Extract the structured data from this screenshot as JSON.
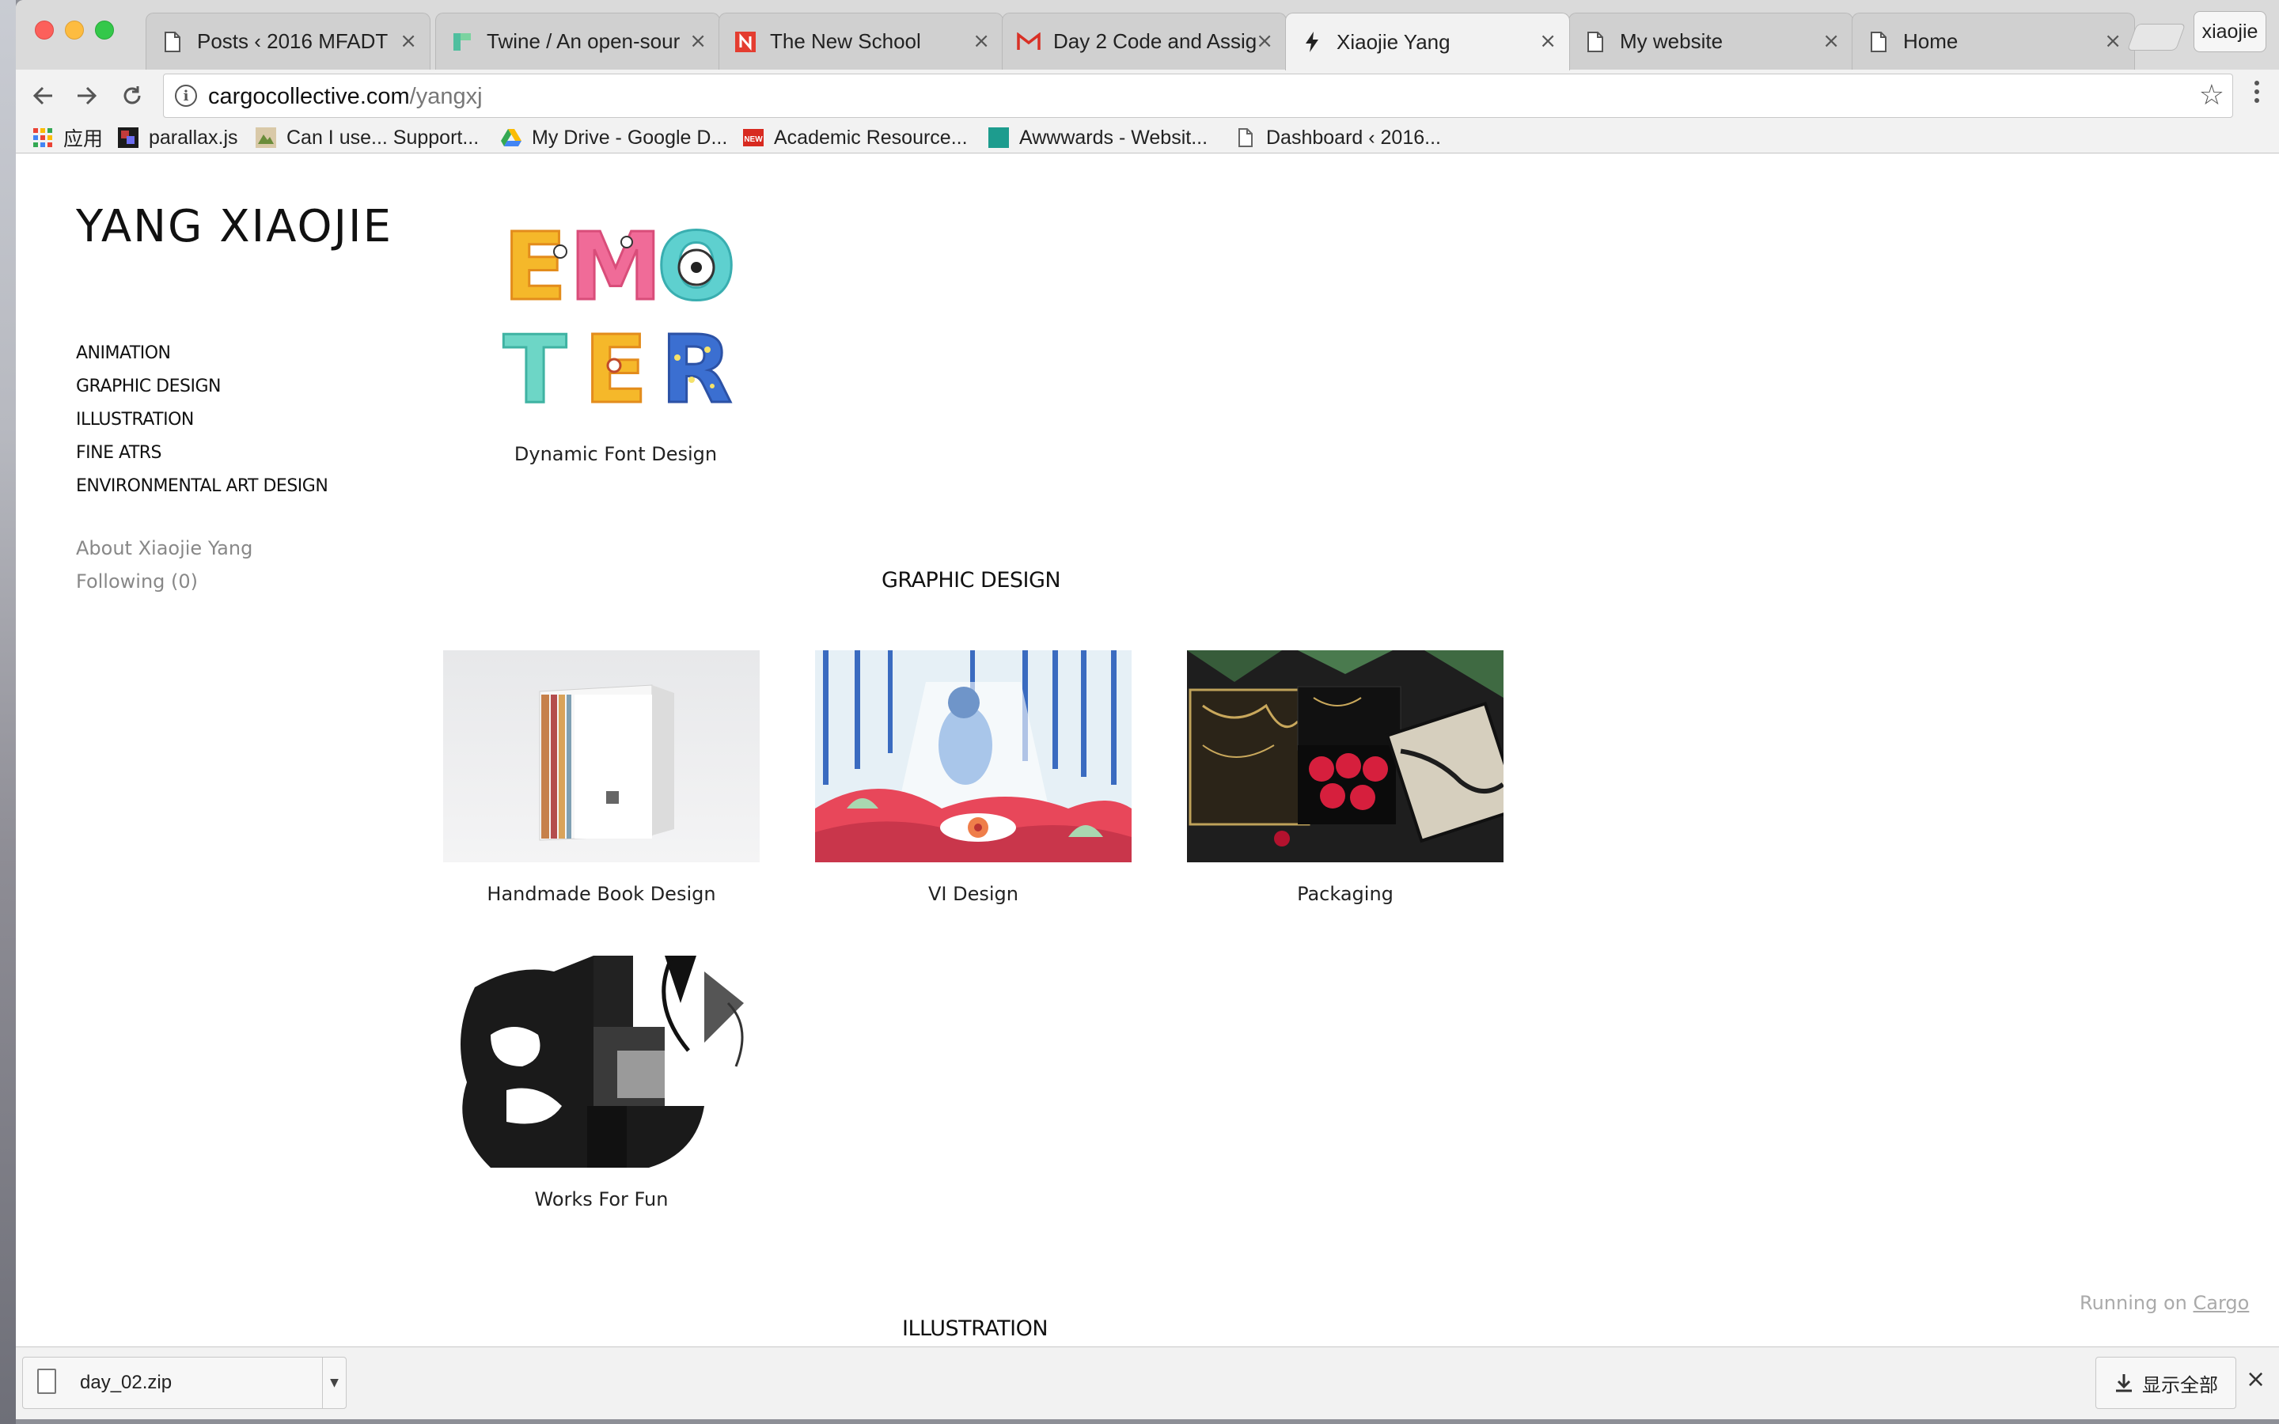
{
  "browser": {
    "tabs": [
      {
        "title": "Posts ‹ 2016 MFADT",
        "favicon": "document-icon",
        "active": false
      },
      {
        "title": "Twine / An open-sour",
        "favicon": "twine-icon",
        "active": false
      },
      {
        "title": "The New School",
        "favicon": "new-school-icon",
        "active": false
      },
      {
        "title": "Day 2 Code and Assig",
        "favicon": "gmail-icon",
        "active": false
      },
      {
        "title": "Xiaojie Yang",
        "favicon": "lightning-icon",
        "active": true
      },
      {
        "title": "My website",
        "favicon": "document-icon",
        "active": false
      },
      {
        "title": "Home",
        "favicon": "document-icon",
        "active": false
      }
    ],
    "tab_close_glyph": "×",
    "profile_name": "xiaojie",
    "address": {
      "host": "cargocollective.com",
      "path": "/yangxj"
    },
    "bookmarks": [
      {
        "label": "应用",
        "icon": "apps-grid-icon"
      },
      {
        "label": "parallax.js",
        "icon": "parallax-icon"
      },
      {
        "label": "Can I use... Support...",
        "icon": "caniuse-icon"
      },
      {
        "label": "My Drive - Google D...",
        "icon": "google-drive-icon"
      },
      {
        "label": "Academic Resource...",
        "icon": "new-badge-icon"
      },
      {
        "label": "Awwwards - Websit...",
        "icon": "awwwards-icon"
      },
      {
        "label": "Dashboard ‹ 2016...",
        "icon": "document-icon"
      }
    ]
  },
  "site": {
    "title": "YANG XIAOJIE",
    "nav": [
      "ANIMATION",
      "GRAPHIC DESIGN",
      "ILLUSTRATION",
      "FINE ATRS",
      "ENVIRONMENTAL ART DESIGN"
    ],
    "about": "About Xiaojie Yang",
    "following": "Following  (0)",
    "featured": {
      "caption": "Dynamic Font Design",
      "letters": [
        "E",
        "M",
        "O",
        "T",
        "E",
        "R"
      ]
    },
    "sections": [
      {
        "heading": "GRAPHIC DESIGN",
        "projects": [
          {
            "caption": "Handmade Book Design"
          },
          {
            "caption": "VI Design"
          },
          {
            "caption": "Packaging"
          },
          {
            "caption": "Works For Fun"
          }
        ]
      },
      {
        "heading": "ILLUSTRATION"
      }
    ],
    "running_prefix": "Running on ",
    "running_link": "Cargo"
  },
  "download_bar": {
    "file_name": "day_02.zip",
    "show_all_label": "显示全部"
  },
  "colors": {
    "traffic_red": "#fc605b",
    "traffic_yellow": "#fdbc40",
    "traffic_green": "#34c84a",
    "gmail_red": "#d93025",
    "twine_green": "#4fbf9f"
  }
}
